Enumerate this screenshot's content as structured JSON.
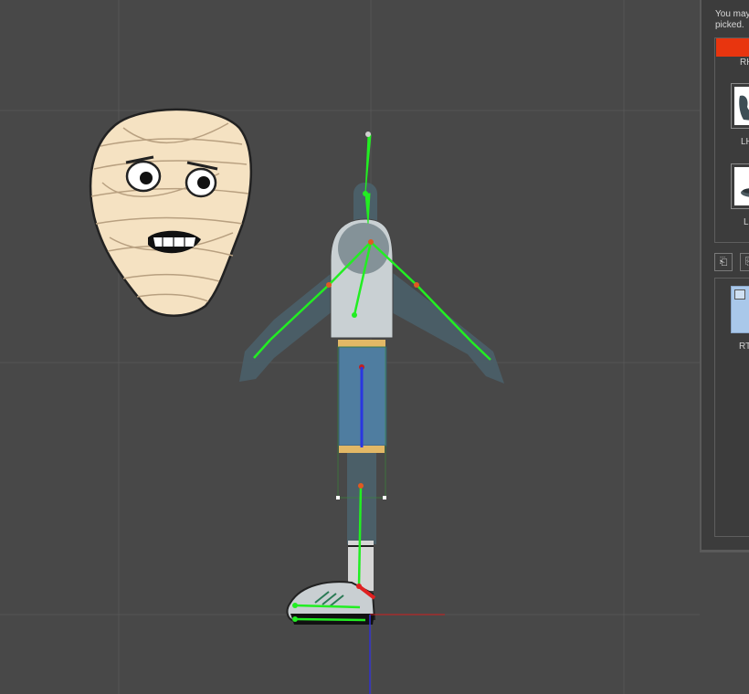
{
  "viewport": {
    "background": "#484848",
    "grid_color": "#555555",
    "bone_color": "#22ee22",
    "axis_x_color": "#d02020",
    "axis_y_color": "#3030d0"
  },
  "side_panel": {
    "hint_line1": "You may",
    "hint_line2": "picked.",
    "slots": [
      {
        "label": "RH",
        "thumbnail_icon": "red-selection-bar"
      },
      {
        "label": "LH",
        "thumbnail_icon": "dark-hand-thumbnail"
      },
      {
        "label": "LH",
        "thumbnail_icon": "flat-hand-thumbnail"
      }
    ],
    "tool_buttons": [
      {
        "icon": "import-icon"
      },
      {
        "icon": "export-icon"
      }
    ],
    "rt_label": "RT",
    "accent_color": "#e8350f"
  }
}
